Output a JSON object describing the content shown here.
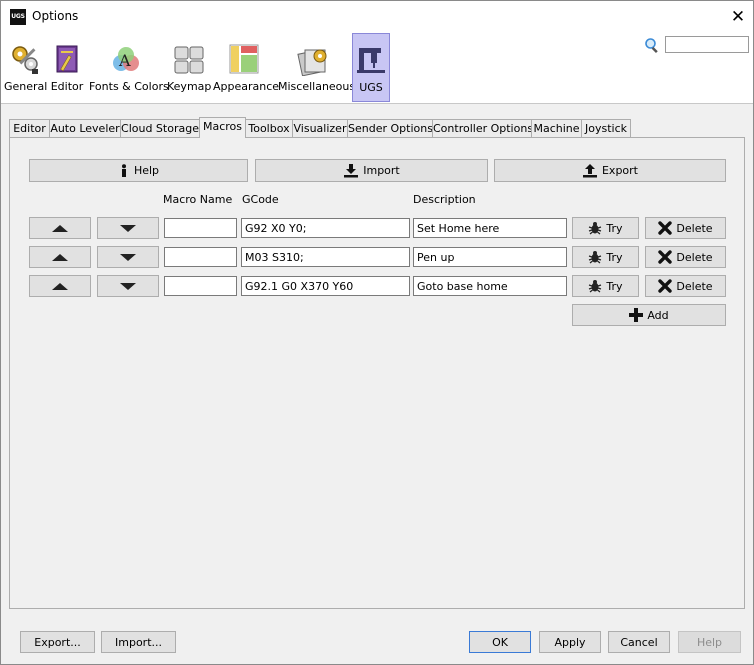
{
  "window": {
    "title": "Options",
    "logo_text": "UGS"
  },
  "categories": [
    {
      "label": "General"
    },
    {
      "label": "Editor"
    },
    {
      "label": "Fonts & Colors"
    },
    {
      "label": "Keymap"
    },
    {
      "label": "Appearance"
    },
    {
      "label": "Miscellaneous"
    },
    {
      "label": "UGS"
    }
  ],
  "search": {
    "value": ""
  },
  "tabs": [
    {
      "label": "Editor"
    },
    {
      "label": "Auto Leveler"
    },
    {
      "label": "Cloud Storage"
    },
    {
      "label": "Macros"
    },
    {
      "label": "Toolbox"
    },
    {
      "label": "Visualizer"
    },
    {
      "label": "Sender Options"
    },
    {
      "label": "Controller Options"
    },
    {
      "label": "Machine"
    },
    {
      "label": "Joystick"
    }
  ],
  "toolbar": {
    "help": "Help",
    "import": "Import",
    "export": "Export"
  },
  "columns": {
    "name": "Macro Name",
    "gcode": "GCode",
    "description": "Description"
  },
  "macros": [
    {
      "name": "",
      "gcode": "G92 X0 Y0;",
      "description": "Set Home here"
    },
    {
      "name": "",
      "gcode": "M03 S310;",
      "description": "Pen up"
    },
    {
      "name": "",
      "gcode": "G92.1 G0 X370 Y60",
      "description": "Goto base home"
    }
  ],
  "row_actions": {
    "try": "Try",
    "delete": "Delete"
  },
  "add_label": "Add",
  "footer": {
    "export": "Export...",
    "import": "Import...",
    "ok": "OK",
    "apply": "Apply",
    "cancel": "Cancel",
    "help": "Help"
  },
  "colors": {
    "selected_category": "#c8c6f4",
    "ok_border": "#3a7ad6"
  }
}
